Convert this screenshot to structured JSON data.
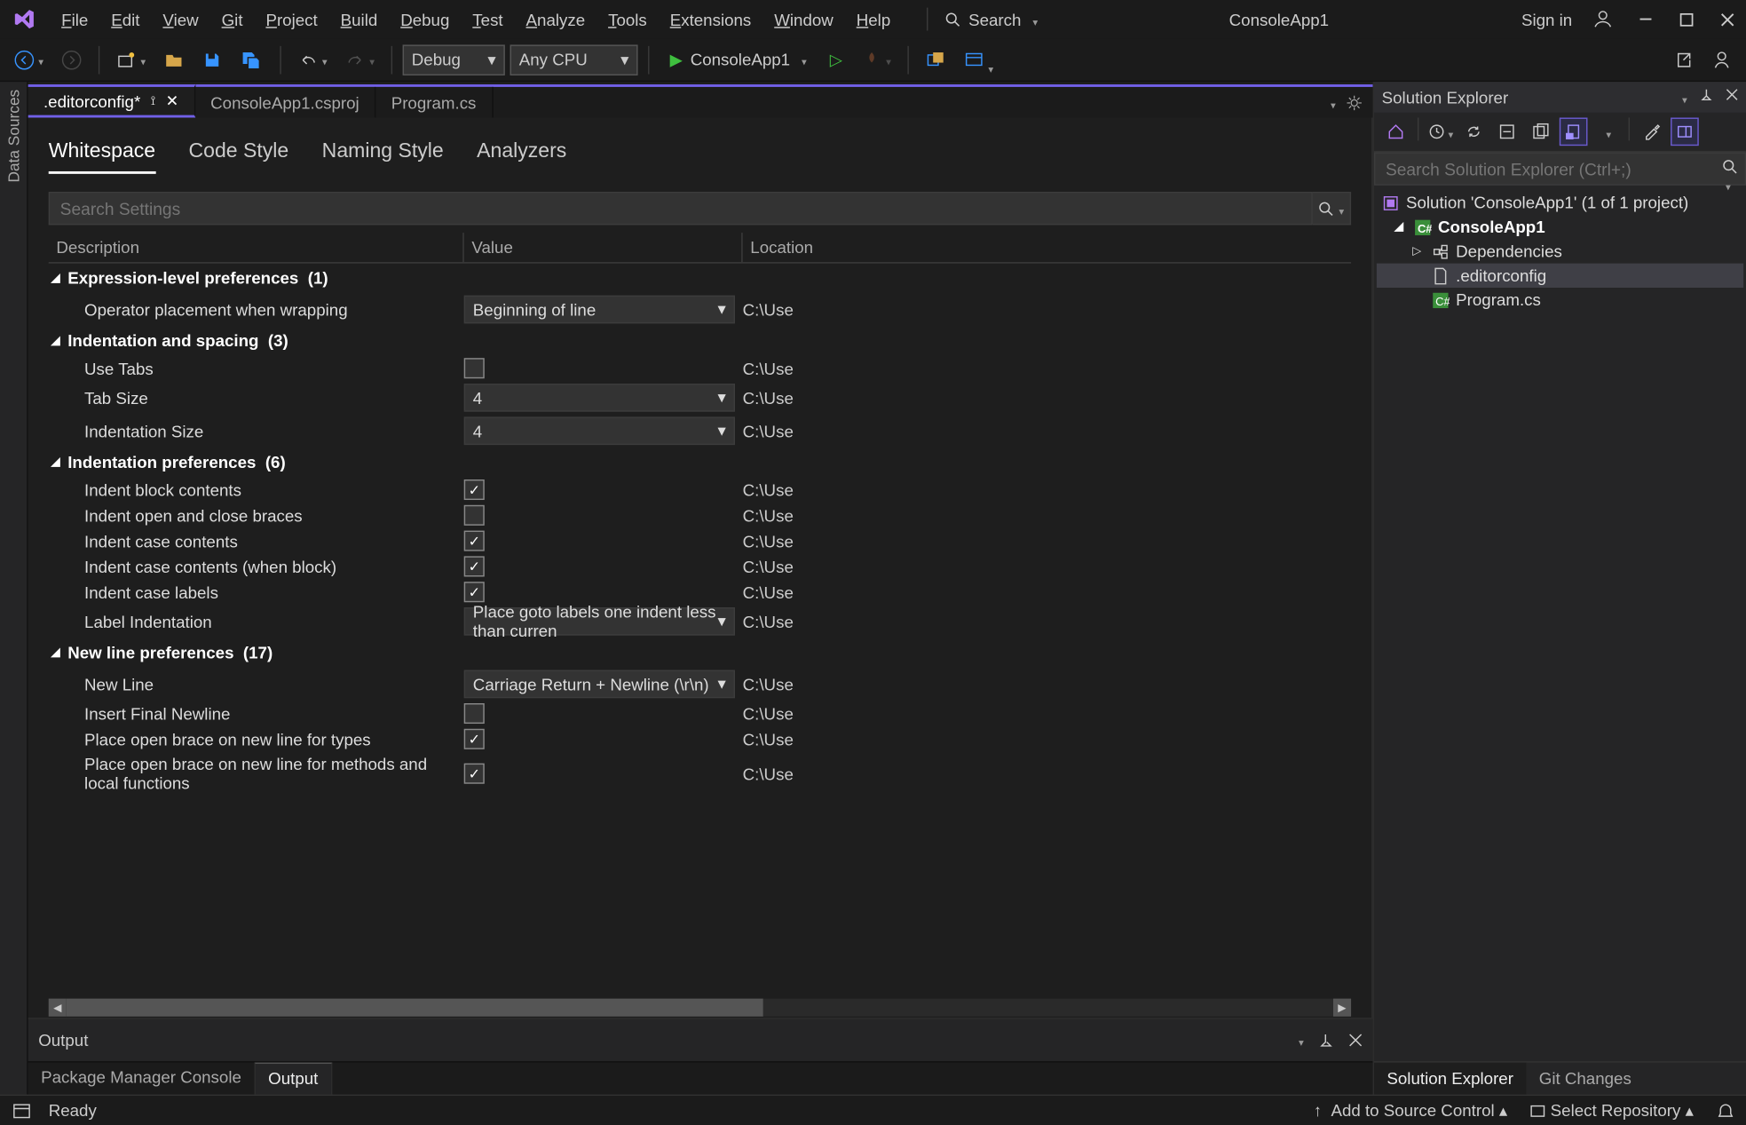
{
  "titlebar": {
    "menu": [
      "File",
      "Edit",
      "View",
      "Git",
      "Project",
      "Build",
      "Debug",
      "Test",
      "Analyze",
      "Tools",
      "Extensions",
      "Window",
      "Help"
    ],
    "search_label": "Search",
    "app_name": "ConsoleApp1",
    "signin": "Sign in"
  },
  "toolbar": {
    "config": "Debug",
    "platform": "Any CPU",
    "start_target": "ConsoleApp1"
  },
  "doc_tabs": [
    {
      "label": ".editorconfig*",
      "active": true,
      "pinned": true,
      "closable": true
    },
    {
      "label": "ConsoleApp1.csproj",
      "active": false
    },
    {
      "label": "Program.cs",
      "active": false
    }
  ],
  "config_tabs": [
    "Whitespace",
    "Code Style",
    "Naming Style",
    "Analyzers"
  ],
  "config_tab_active": "Whitespace",
  "search_settings_placeholder": "Search Settings",
  "grid": {
    "columns": [
      "Description",
      "Value",
      "Location"
    ],
    "groups": [
      {
        "name": "Expression-level preferences",
        "count": 1,
        "rows": [
          {
            "desc": "Operator placement when wrapping",
            "type": "combo",
            "value": "Beginning of line",
            "loc": "C:\\Use"
          }
        ]
      },
      {
        "name": "Indentation and spacing",
        "count": 3,
        "rows": [
          {
            "desc": "Use Tabs",
            "type": "check",
            "value": false,
            "loc": "C:\\Use"
          },
          {
            "desc": "Tab Size",
            "type": "combo",
            "value": "4",
            "loc": "C:\\Use"
          },
          {
            "desc": "Indentation Size",
            "type": "combo",
            "value": "4",
            "loc": "C:\\Use"
          }
        ]
      },
      {
        "name": "Indentation preferences",
        "count": 6,
        "rows": [
          {
            "desc": "Indent block contents",
            "type": "check",
            "value": true,
            "loc": "C:\\Use"
          },
          {
            "desc": "Indent open and close braces",
            "type": "check",
            "value": false,
            "loc": "C:\\Use"
          },
          {
            "desc": "Indent case contents",
            "type": "check",
            "value": true,
            "loc": "C:\\Use"
          },
          {
            "desc": "Indent case contents (when block)",
            "type": "check",
            "value": true,
            "loc": "C:\\Use"
          },
          {
            "desc": "Indent case labels",
            "type": "check",
            "value": true,
            "loc": "C:\\Use"
          },
          {
            "desc": "Label Indentation",
            "type": "combo",
            "value": "Place goto labels one indent less than curren",
            "loc": "C:\\Use"
          }
        ]
      },
      {
        "name": "New line preferences",
        "count": 17,
        "rows": [
          {
            "desc": "New Line",
            "type": "combo",
            "value": "Carriage Return + Newline (\\r\\n)",
            "loc": "C:\\Use"
          },
          {
            "desc": "Insert Final Newline",
            "type": "check",
            "value": false,
            "loc": "C:\\Use"
          },
          {
            "desc": "Place open brace on new line for types",
            "type": "check",
            "value": true,
            "loc": "C:\\Use"
          },
          {
            "desc": "Place open brace on new line for methods and local functions",
            "type": "check",
            "value": true,
            "loc": "C:\\Use"
          }
        ]
      }
    ]
  },
  "output": {
    "title": "Output"
  },
  "bottom_tabs": [
    "Package Manager Console",
    "Output"
  ],
  "bottom_tab_active": "Output",
  "solution_explorer": {
    "title": "Solution Explorer",
    "search_placeholder": "Search Solution Explorer (Ctrl+;)",
    "solution_label": "Solution 'ConsoleApp1' (1 of 1 project)",
    "project": "ConsoleApp1",
    "items": [
      "Dependencies",
      ".editorconfig",
      "Program.cs"
    ]
  },
  "right_bottom_tabs": [
    "Solution Explorer",
    "Git Changes"
  ],
  "statusbar": {
    "ready": "Ready",
    "source_control": "Add to Source Control",
    "select_repo": "Select Repository"
  }
}
